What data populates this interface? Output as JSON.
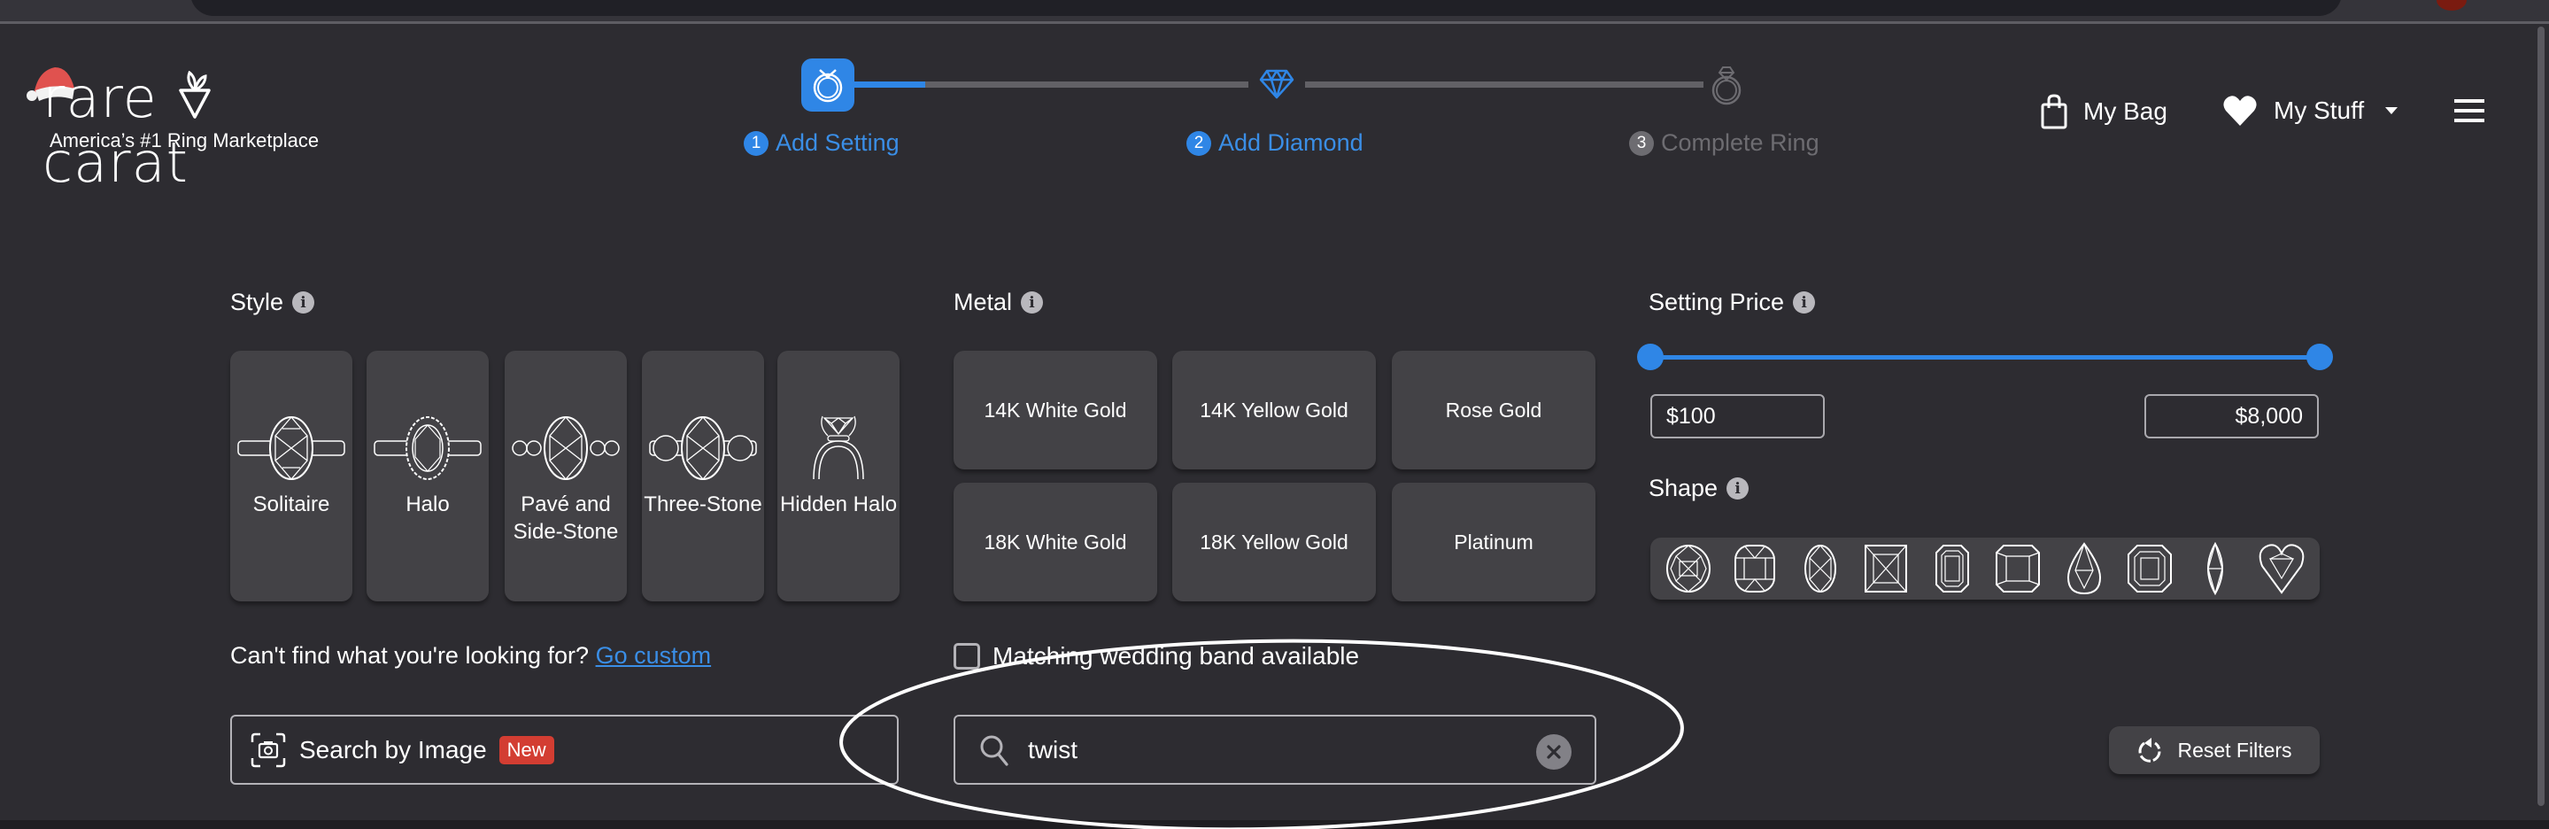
{
  "brand": {
    "name": "rare carat",
    "tagline": "America’s #1 Ring Marketplace"
  },
  "stepper": {
    "steps": [
      {
        "number": "1",
        "label": "Add Setting",
        "state": "active"
      },
      {
        "number": "2",
        "label": "Add Diamond",
        "state": "next"
      },
      {
        "number": "3",
        "label": "Complete Ring",
        "state": "inactive"
      }
    ],
    "progress_fraction_step1": 0.17
  },
  "header": {
    "bag_label": "My Bag",
    "stuff_label": "My Stuff",
    "icons": {
      "bag": "shopping-bag-icon",
      "heart": "heart-icon",
      "caret": "caret-down-icon",
      "menu": "hamburger-menu-icon"
    }
  },
  "style": {
    "title": "Style",
    "options": [
      {
        "label": "Solitaire",
        "icon": "solitaire-ring-icon"
      },
      {
        "label": "Halo",
        "icon": "halo-ring-icon"
      },
      {
        "label": "Pavé and Side-Stone",
        "icon": "pave-ring-icon"
      },
      {
        "label": "Three-Stone",
        "icon": "three-stone-ring-icon"
      },
      {
        "label": "Hidden Halo",
        "icon": "hidden-halo-ring-icon"
      }
    ]
  },
  "metal": {
    "title": "Metal",
    "options": [
      "14K White Gold",
      "14K Yellow Gold",
      "Rose Gold",
      "18K White Gold",
      "18K Yellow Gold",
      "Platinum"
    ]
  },
  "price": {
    "title": "Setting Price",
    "min_value": "$100",
    "max_value": "$8,000",
    "slider_min_fraction": 0.0,
    "slider_max_fraction": 1.0
  },
  "shape": {
    "title": "Shape",
    "options": [
      "Round",
      "Cushion",
      "Oval",
      "Princess",
      "Emerald",
      "Radiant",
      "Pear",
      "Asscher",
      "Marquise",
      "Heart"
    ]
  },
  "custom": {
    "prompt": "Can't find what you're looking for?",
    "link": "Go custom"
  },
  "matching_band": {
    "label": "Matching wedding band available",
    "checked": false
  },
  "image_search": {
    "label": "Search by Image",
    "badge": "New"
  },
  "search": {
    "value": "twist"
  },
  "reset": {
    "label": "Reset Filters"
  },
  "colors": {
    "accent": "#2f86e6",
    "background": "#2d2c31",
    "card": "#434246",
    "badge": "#d33d32"
  }
}
